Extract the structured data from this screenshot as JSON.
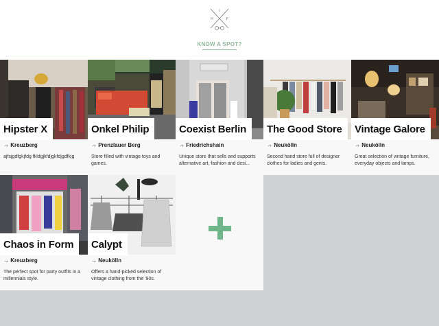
{
  "header": {
    "logo_name": "glasses-logo-icon",
    "logo_letters": [
      "I",
      "H",
      "P"
    ],
    "know_link": "KNOW A SPOT?"
  },
  "shops": [
    {
      "name": "Hipster X",
      "location": "→ Kreuzberg",
      "description": "ajfsjgdfgkjfdg fkldgjkfdjgkfdjgdfkjg"
    },
    {
      "name": "Onkel Philip",
      "location": "→ Prenzlauer Berg",
      "description": "Store filled with vintage toys and games."
    },
    {
      "name": "Coexist Berlin",
      "location": "→ Friedrichshain",
      "description": "Unique store that sells and supports alternative art, fashion and desi..."
    },
    {
      "name": "The Good Store",
      "location": "→ Neukölln",
      "description": "Second hand store full of designer clothes for ladies and gents."
    },
    {
      "name": "Vintage Galore",
      "location": "→ Neukölln",
      "description": "Great selection of vintage furniture, everyday objects and lamps."
    },
    {
      "name": "Chaos in Form",
      "location": "→ Kreuzberg",
      "description": "The perfect spot for party outfits in a millennials style."
    },
    {
      "name": "Calypt",
      "location": "→ Neukölln",
      "description": "Offers a hand-picked selection of vintage clothing from the '90s."
    }
  ],
  "add_card": {
    "icon": "plus-icon"
  },
  "colors": {
    "accent": "#6fb58a",
    "backdrop": "#cfd1d3",
    "card": "#f8f8f8"
  }
}
